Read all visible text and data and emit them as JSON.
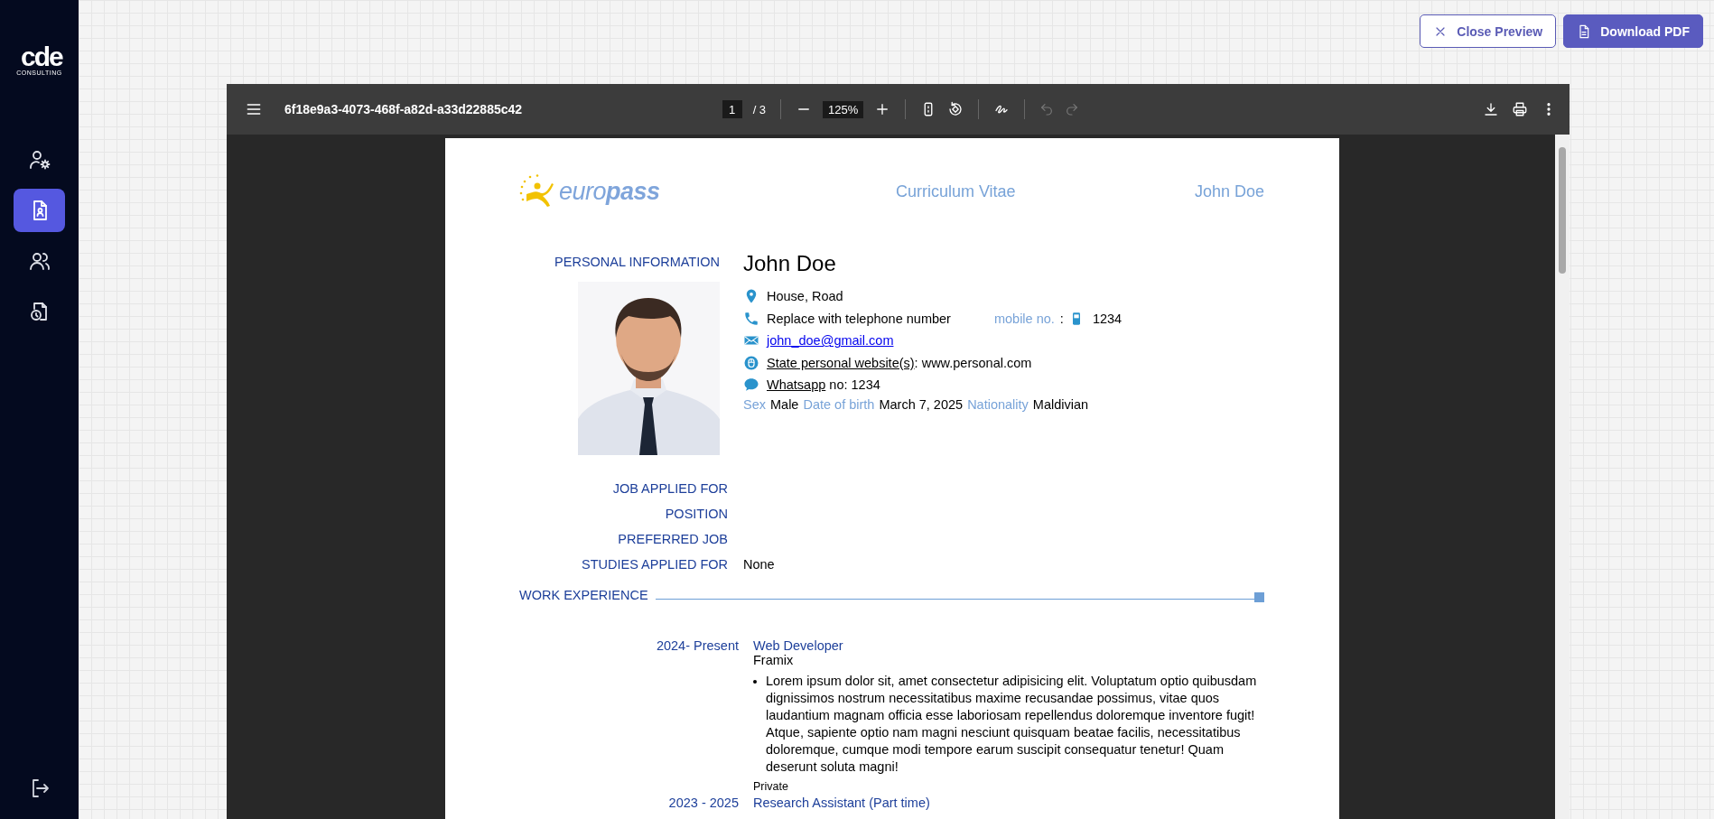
{
  "sidebar": {
    "logo": "cde",
    "logo_subtitle": "CONSULTING",
    "items": [
      {
        "kind": "settings",
        "selected": false
      },
      {
        "kind": "resume",
        "selected": true
      },
      {
        "kind": "team",
        "selected": false
      },
      {
        "kind": "history",
        "selected": false
      }
    ]
  },
  "header_buttons": [
    {
      "kind": "outline",
      "label": "Close Preview"
    },
    {
      "kind": "primary",
      "label": "Download PDF"
    }
  ],
  "viewer": {
    "file_name": "6f18e9a3-4073-468f-a82d-a33d22885c42",
    "page": "1",
    "page_count": "/ 3",
    "zoom": "125%",
    "history_buttons": [
      {
        "kind": "undo",
        "disabled": true
      },
      {
        "kind": "redo",
        "disabled": true
      }
    ]
  },
  "document": {
    "logo": "euro**pass**",
    "title": "Curriculum Vitae",
    "header_name": "John Doe",
    "personal": {
      "section_label": "PERSONAL INFORMATION",
      "name": "John Doe",
      "contacts": [
        {
          "kind": "address",
          "text": "House, Road"
        },
        {
          "kind": "phone",
          "text": "Replace with telephone number",
          "mobile_label": "mobile no.",
          "mobile_separator": ":",
          "mobile": "1234"
        },
        {
          "kind": "email",
          "link": "john_doe@gmail.com"
        },
        {
          "kind": "website",
          "link": "State personal website(s)",
          "text": ": www.personal.com"
        },
        {
          "kind": "chat",
          "link": "Whatsapp",
          "text": " no: 1234"
        }
      ],
      "details": [
        {
          "label": "Sex",
          "value": "Male"
        },
        {
          "label": "Date of birth",
          "value": "March 7, 2025"
        },
        {
          "label": "Nationality",
          "value": "Maldivian"
        }
      ]
    },
    "job_fields": [
      {
        "label": "JOB APPLIED FOR"
      },
      {
        "label": "POSITION"
      },
      {
        "label": "PREFERRED JOB"
      },
      {
        "label": "STUDIES APPLIED FOR",
        "value": "None"
      }
    ],
    "work_experience": {
      "section_label": "WORK EXPERIENCE",
      "entries": [
        {
          "dates": "2024- Present",
          "title": "Web Developer",
          "employer": "Framix",
          "bullets": [
            "Lorem ipsum dolor sit, amet consectetur adipisicing elit. Voluptatum optio quibusdam dignissimos nostrum necessitatibus maxime recusandae possimus, vitae quos laudantium magnam officia esse laboriosam repellendus doloremque inventore fugit! Atque, sapiente optio nam magni nesciunt quisquam beatae facilis, necessitatibus doloremque, cumque modi tempore earum suscipit consequatur tenetur! Quam deserunt soluta magni!"
          ],
          "type": "Private"
        },
        {
          "dates": "2023 - 2025",
          "title": "Research Assistant (Part time)"
        }
      ]
    }
  }
}
